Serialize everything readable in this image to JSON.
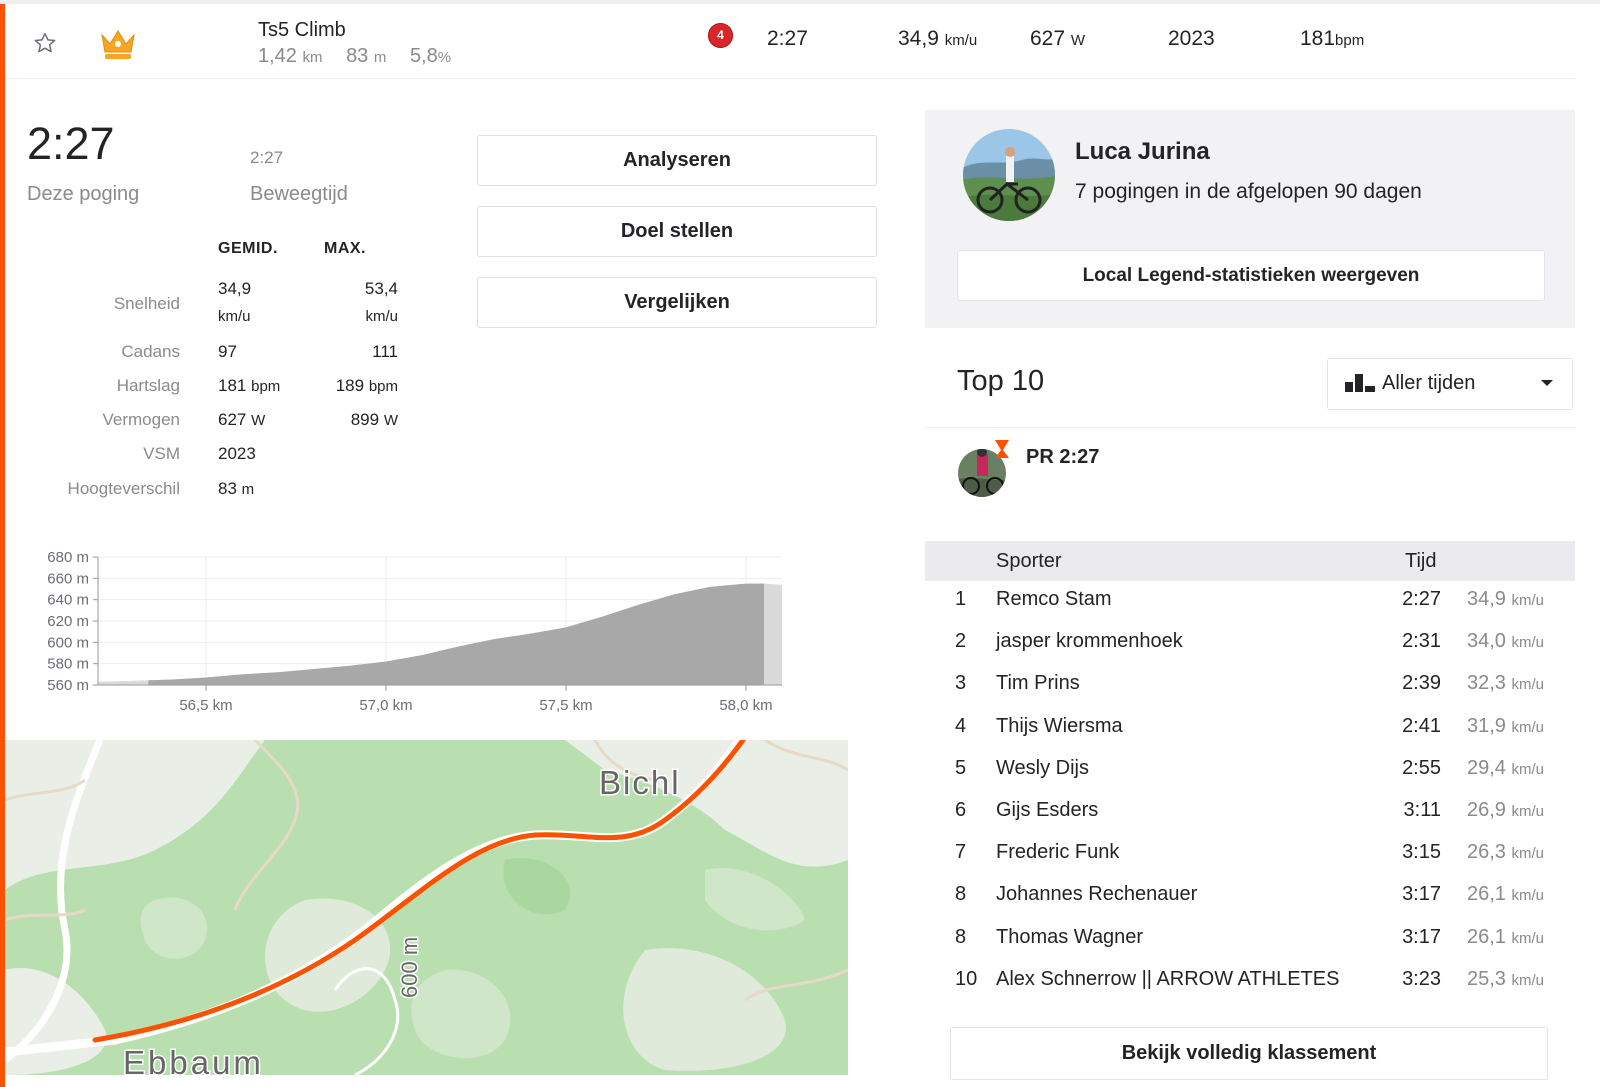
{
  "segment": {
    "name": "Ts5 Climb",
    "distance": "1,42",
    "distance_unit": "km",
    "elevation": "83",
    "elevation_unit": "m",
    "grade": "5,8",
    "grade_unit": "%",
    "rank_badge": "4",
    "time": "2:27",
    "speed": "34,9",
    "speed_unit": "km/u",
    "power": "627",
    "power_unit": "W",
    "vsm": "2023",
    "heart_rate": "181",
    "heart_rate_unit": "bpm"
  },
  "effort": {
    "time": "2:27",
    "time_label": "Deze poging",
    "moving_time": "2:27",
    "moving_label": "Beweegtijd",
    "col_avg": "GEMID.",
    "col_max": "MAX.",
    "stats": [
      {
        "label": "Snelheid",
        "avg": "34,9",
        "avg_unit": "km/u",
        "max": "53,4",
        "max_unit": "km/u"
      },
      {
        "label": "Cadans",
        "avg": "97",
        "max": "111"
      },
      {
        "label": "Hartslag",
        "avg": "181",
        "avg_unit": "bpm",
        "max": "189",
        "max_unit": "bpm"
      },
      {
        "label": "Vermogen",
        "avg": "627",
        "avg_unit": "W",
        "max": "899",
        "max_unit": "W"
      },
      {
        "label": "VSM",
        "avg": "2023"
      },
      {
        "label": "Hoogteverschil",
        "avg": "83",
        "avg_unit": "m"
      }
    ]
  },
  "actions": {
    "analyze": "Analyseren",
    "set_goal": "Doel stellen",
    "compare": "Vergelijken"
  },
  "chart_data": {
    "type": "area",
    "x": [
      56.2,
      56.3,
      56.4,
      56.5,
      56.6,
      56.7,
      56.8,
      56.9,
      57.0,
      57.1,
      57.2,
      57.3,
      57.4,
      57.5,
      57.6,
      57.7,
      57.8,
      57.9,
      58.0,
      58.05,
      58.1
    ],
    "y": [
      563,
      564,
      565,
      567,
      570,
      572,
      575,
      578,
      582,
      588,
      596,
      603,
      608,
      614,
      624,
      635,
      645,
      652,
      655,
      655,
      654
    ],
    "highlight_range_km": [
      56.34,
      58.05
    ],
    "ylim": [
      560,
      680
    ],
    "yticks": [
      "680 m",
      "660 m",
      "640 m",
      "620 m",
      "600 m",
      "580 m",
      "560 m"
    ],
    "xticks": [
      "56,5 km",
      "57,0 km",
      "57,5 km",
      "58,0 km"
    ],
    "ytick_values": [
      680,
      660,
      640,
      620,
      600,
      580,
      560
    ],
    "xtick_values": [
      56.5,
      57.0,
      57.5,
      58.0
    ],
    "grid": true
  },
  "map": {
    "place_bichl": "Bichl",
    "place_ebbaum": "Ebbaum",
    "contour_label": "600 m",
    "route_color": "#fc5200"
  },
  "local_legend": {
    "name": "Luca Jurina",
    "subtitle": "7 pogingen in de afgelopen 90 dagen",
    "button": "Local Legend-statistieken weergeven"
  },
  "leaderboard": {
    "title": "Top 10",
    "filter": "Aller tijden",
    "pr_label": "PR",
    "pr_time": "2:27",
    "col_athlete": "Sporter",
    "col_time": "Tijd",
    "speed_unit": "km/u",
    "rows": [
      {
        "rank": "1",
        "name": "Remco Stam",
        "time": "2:27",
        "speed": "34,9"
      },
      {
        "rank": "2",
        "name": "jasper krommenhoek",
        "time": "2:31",
        "speed": "34,0"
      },
      {
        "rank": "3",
        "name": "Tim Prins",
        "time": "2:39",
        "speed": "32,3"
      },
      {
        "rank": "4",
        "name": "Thijs Wiersma",
        "time": "2:41",
        "speed": "31,9"
      },
      {
        "rank": "5",
        "name": "Wesly Dijs",
        "time": "2:55",
        "speed": "29,4"
      },
      {
        "rank": "6",
        "name": "Gijs Esders",
        "time": "3:11",
        "speed": "26,9"
      },
      {
        "rank": "7",
        "name": "Frederic Funk",
        "time": "3:15",
        "speed": "26,3"
      },
      {
        "rank": "8",
        "name": "Johannes Rechenauer",
        "time": "3:17",
        "speed": "26,1"
      },
      {
        "rank": "8",
        "name": "Thomas Wagner",
        "time": "3:17",
        "speed": "26,1"
      },
      {
        "rank": "10",
        "name": "Alex Schnerrow || ARROW ATHLETES",
        "time": "3:23",
        "speed": "25,3"
      }
    ],
    "full_button": "Bekijk volledig klassement"
  },
  "colors": {
    "accent": "#fc5200",
    "badge": "#d8262a",
    "crown": "#f5a623"
  }
}
